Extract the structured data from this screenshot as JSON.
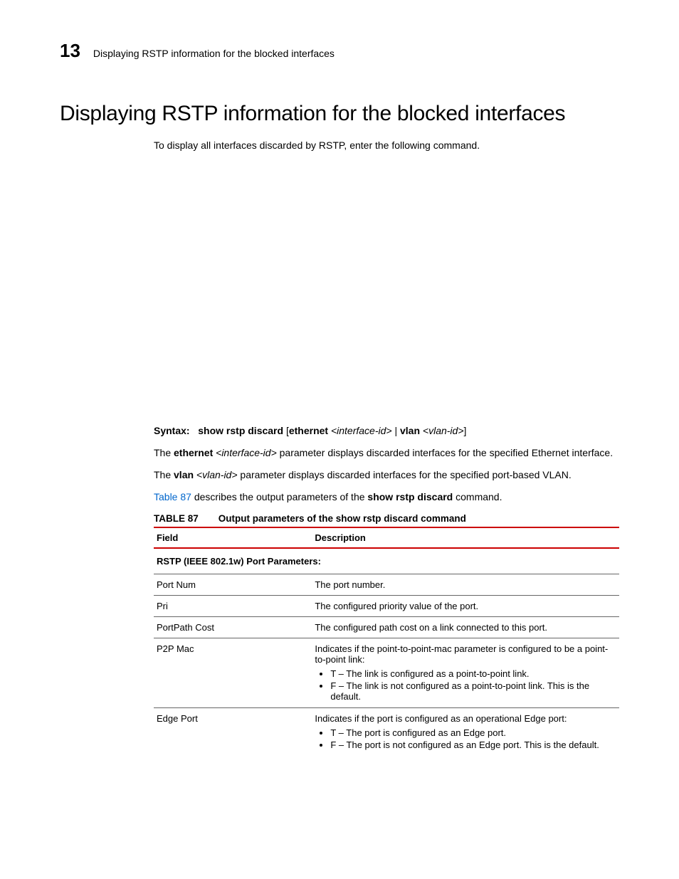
{
  "header": {
    "chapter_number": "13",
    "chapter_title": "Displaying RSTP information for the blocked interfaces"
  },
  "section": {
    "title": "Displaying RSTP information for the blocked interfaces",
    "intro": "To display all interfaces discarded by RSTP, enter the following command.",
    "syntax": {
      "label": "Syntax:",
      "cmd": "show rstp discard",
      "after_cmd_open": " [",
      "eth_kw": "ethernet",
      "eth_arg": " <interface-id>",
      "pipe": " | ",
      "vlan_kw": "vlan",
      "vlan_arg": " <vlan-id>",
      "close": "]"
    },
    "p_eth_a": "The ",
    "p_eth_bold": "ethernet",
    "p_eth_ital": " <interface-id>",
    "p_eth_b": " parameter displays discarded interfaces for the specified Ethernet interface.",
    "p_vlan_a": "The ",
    "p_vlan_bold": "vlan",
    "p_vlan_ital": " <vlan-id>",
    "p_vlan_b": " parameter displays discarded interfaces for the specified port-based VLAN.",
    "p_xref_link": "Table 87",
    "p_xref_mid": " describes the output parameters of the ",
    "p_xref_bold": "show rstp discard",
    "p_xref_end": " command."
  },
  "table": {
    "number": "TABLE 87",
    "caption": "Output parameters of the show rstp discard command",
    "head_field": "Field",
    "head_desc": "Description",
    "subhead": "RSTP (IEEE 802.1w) Port Parameters:",
    "rows": {
      "r1f": "Port Num",
      "r1d": "The port number.",
      "r2f": "Pri",
      "r2d": "The configured priority value of the port.",
      "r3f": "PortPath Cost",
      "r3d": "The configured path cost on a link connected to this port.",
      "r4f": "P2P Mac",
      "r4d_intro": "Indicates if the point-to-point-mac parameter is configured to be a point-to-point link:",
      "r4d_b1": "T – The link is configured as a point-to-point link.",
      "r4d_b2": "F – The link is not configured as a point-to-point link. This is the default.",
      "r5f": "Edge Port",
      "r5d_intro": "Indicates if the port is configured as an operational Edge port:",
      "r5d_b1": "T – The port is configured as an Edge port.",
      "r5d_b2": "F – The port is not configured as an Edge port. This is the default."
    }
  }
}
